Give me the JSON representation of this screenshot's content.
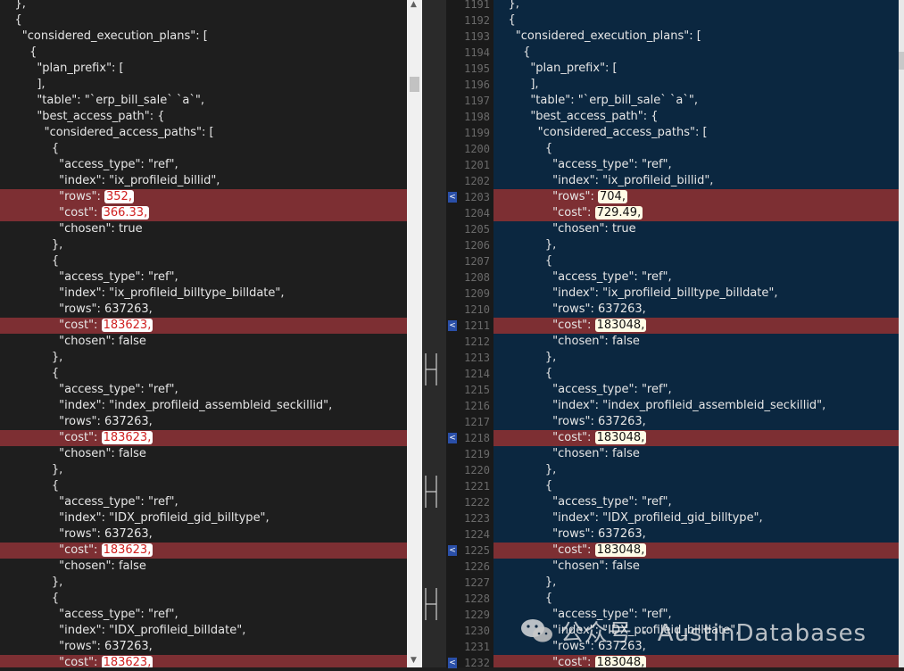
{
  "left_pane": {
    "lines": [
      {
        "indent": "    ",
        "parts": [
          {
            "t": "},"
          }
        ]
      },
      {
        "indent": "    ",
        "parts": [
          {
            "t": "{"
          }
        ]
      },
      {
        "indent": "      ",
        "parts": [
          {
            "t": "\"considered_execution_plans\": ["
          }
        ]
      },
      {
        "indent": "        ",
        "parts": [
          {
            "t": "{"
          }
        ]
      },
      {
        "indent": "          ",
        "parts": [
          {
            "t": "\"plan_prefix\": ["
          }
        ]
      },
      {
        "indent": "          ",
        "parts": [
          {
            "t": "],"
          }
        ]
      },
      {
        "indent": "          ",
        "parts": [
          {
            "t": "\"table\": \"`erp_bill_sale` `a`\","
          }
        ]
      },
      {
        "indent": "          ",
        "parts": [
          {
            "t": "\"best_access_path\": {"
          }
        ]
      },
      {
        "indent": "            ",
        "parts": [
          {
            "t": "\"considered_access_paths\": ["
          }
        ]
      },
      {
        "indent": "              ",
        "parts": [
          {
            "t": "{"
          }
        ]
      },
      {
        "indent": "                ",
        "parts": [
          {
            "t": "\"access_type\": \"ref\","
          }
        ]
      },
      {
        "indent": "                ",
        "parts": [
          {
            "t": "\"index\": \"ix_profileid_billid\","
          }
        ]
      },
      {
        "indent": "                ",
        "changed": true,
        "parts": [
          {
            "t": "\"rows\": "
          },
          {
            "t": "352,",
            "hl": true
          }
        ]
      },
      {
        "indent": "                ",
        "changed": true,
        "parts": [
          {
            "t": "\"cost\": "
          },
          {
            "t": "366.33,",
            "hl": true
          }
        ]
      },
      {
        "indent": "                ",
        "parts": [
          {
            "t": "\"chosen\": true"
          }
        ]
      },
      {
        "indent": "              ",
        "parts": [
          {
            "t": "},"
          }
        ]
      },
      {
        "indent": "              ",
        "parts": [
          {
            "t": "{"
          }
        ]
      },
      {
        "indent": "                ",
        "parts": [
          {
            "t": "\"access_type\": \"ref\","
          }
        ]
      },
      {
        "indent": "                ",
        "parts": [
          {
            "t": "\"index\": \"ix_profileid_billtype_billdate\","
          }
        ]
      },
      {
        "indent": "                ",
        "parts": [
          {
            "t": "\"rows\": 637263,"
          }
        ]
      },
      {
        "indent": "                ",
        "changed": true,
        "parts": [
          {
            "t": "\"cost\": "
          },
          {
            "t": "183623,",
            "hl": true
          }
        ]
      },
      {
        "indent": "                ",
        "parts": [
          {
            "t": "\"chosen\": false"
          }
        ]
      },
      {
        "indent": "              ",
        "parts": [
          {
            "t": "},"
          }
        ]
      },
      {
        "indent": "              ",
        "parts": [
          {
            "t": "{"
          }
        ]
      },
      {
        "indent": "                ",
        "parts": [
          {
            "t": "\"access_type\": \"ref\","
          }
        ]
      },
      {
        "indent": "                ",
        "parts": [
          {
            "t": "\"index\": \"index_profileid_assembleid_seckillid\","
          }
        ]
      },
      {
        "indent": "                ",
        "parts": [
          {
            "t": "\"rows\": 637263,"
          }
        ]
      },
      {
        "indent": "                ",
        "changed": true,
        "parts": [
          {
            "t": "\"cost\": "
          },
          {
            "t": "183623,",
            "hl": true
          }
        ]
      },
      {
        "indent": "                ",
        "parts": [
          {
            "t": "\"chosen\": false"
          }
        ]
      },
      {
        "indent": "              ",
        "parts": [
          {
            "t": "},"
          }
        ]
      },
      {
        "indent": "              ",
        "parts": [
          {
            "t": "{"
          }
        ]
      },
      {
        "indent": "                ",
        "parts": [
          {
            "t": "\"access_type\": \"ref\","
          }
        ]
      },
      {
        "indent": "                ",
        "parts": [
          {
            "t": "\"index\": \"IDX_profileid_gid_billtype\","
          }
        ]
      },
      {
        "indent": "                ",
        "parts": [
          {
            "t": "\"rows\": 637263,"
          }
        ]
      },
      {
        "indent": "                ",
        "changed": true,
        "parts": [
          {
            "t": "\"cost\": "
          },
          {
            "t": "183623,",
            "hl": true
          }
        ]
      },
      {
        "indent": "                ",
        "parts": [
          {
            "t": "\"chosen\": false"
          }
        ]
      },
      {
        "indent": "              ",
        "parts": [
          {
            "t": "},"
          }
        ]
      },
      {
        "indent": "              ",
        "parts": [
          {
            "t": "{"
          }
        ]
      },
      {
        "indent": "                ",
        "parts": [
          {
            "t": "\"access_type\": \"ref\","
          }
        ]
      },
      {
        "indent": "                ",
        "parts": [
          {
            "t": "\"index\": \"IDX_profileid_billdate\","
          }
        ]
      },
      {
        "indent": "                ",
        "parts": [
          {
            "t": "\"rows\": 637263,"
          }
        ]
      },
      {
        "indent": "                ",
        "changed": true,
        "parts": [
          {
            "t": "\"cost\": "
          },
          {
            "t": "183623,",
            "hl": true
          }
        ]
      }
    ]
  },
  "right_pane": {
    "lines": [
      {
        "indent": "    ",
        "parts": [
          {
            "t": "},"
          }
        ]
      },
      {
        "indent": "    ",
        "parts": [
          {
            "t": "{"
          }
        ]
      },
      {
        "indent": "      ",
        "parts": [
          {
            "t": "\"considered_execution_plans\": ["
          }
        ]
      },
      {
        "indent": "        ",
        "parts": [
          {
            "t": "{"
          }
        ]
      },
      {
        "indent": "          ",
        "parts": [
          {
            "t": "\"plan_prefix\": ["
          }
        ]
      },
      {
        "indent": "          ",
        "parts": [
          {
            "t": "],"
          }
        ]
      },
      {
        "indent": "          ",
        "parts": [
          {
            "t": "\"table\": \"`erp_bill_sale` `a`\","
          }
        ]
      },
      {
        "indent": "          ",
        "parts": [
          {
            "t": "\"best_access_path\": {"
          }
        ]
      },
      {
        "indent": "            ",
        "parts": [
          {
            "t": "\"considered_access_paths\": ["
          }
        ]
      },
      {
        "indent": "              ",
        "parts": [
          {
            "t": "{"
          }
        ]
      },
      {
        "indent": "                ",
        "parts": [
          {
            "t": "\"access_type\": \"ref\","
          }
        ]
      },
      {
        "indent": "                ",
        "parts": [
          {
            "t": "\"index\": \"ix_profileid_billid\","
          }
        ]
      },
      {
        "indent": "                ",
        "changed": true,
        "parts": [
          {
            "t": "\"rows\": "
          },
          {
            "t": "704,",
            "hl": true
          }
        ]
      },
      {
        "indent": "                ",
        "changed": true,
        "parts": [
          {
            "t": "\"cost\": "
          },
          {
            "t": "729.49,",
            "hl": true
          }
        ]
      },
      {
        "indent": "                ",
        "parts": [
          {
            "t": "\"chosen\": true"
          }
        ]
      },
      {
        "indent": "              ",
        "parts": [
          {
            "t": "},"
          }
        ]
      },
      {
        "indent": "              ",
        "parts": [
          {
            "t": "{"
          }
        ]
      },
      {
        "indent": "                ",
        "parts": [
          {
            "t": "\"access_type\": \"ref\","
          }
        ]
      },
      {
        "indent": "                ",
        "parts": [
          {
            "t": "\"index\": \"ix_profileid_billtype_billdate\","
          }
        ]
      },
      {
        "indent": "                ",
        "parts": [
          {
            "t": "\"rows\": 637263,"
          }
        ]
      },
      {
        "indent": "                ",
        "changed": true,
        "parts": [
          {
            "t": "\"cost\": "
          },
          {
            "t": "183048,",
            "hl": true
          }
        ]
      },
      {
        "indent": "                ",
        "parts": [
          {
            "t": "\"chosen\": false"
          }
        ]
      },
      {
        "indent": "              ",
        "parts": [
          {
            "t": "},"
          }
        ]
      },
      {
        "indent": "              ",
        "parts": [
          {
            "t": "{"
          }
        ]
      },
      {
        "indent": "                ",
        "parts": [
          {
            "t": "\"access_type\": \"ref\","
          }
        ]
      },
      {
        "indent": "                ",
        "parts": [
          {
            "t": "\"index\": \"index_profileid_assembleid_seckillid\","
          }
        ]
      },
      {
        "indent": "                ",
        "parts": [
          {
            "t": "\"rows\": 637263,"
          }
        ]
      },
      {
        "indent": "                ",
        "changed": true,
        "parts": [
          {
            "t": "\"cost\": "
          },
          {
            "t": "183048,",
            "hl": true
          }
        ]
      },
      {
        "indent": "                ",
        "parts": [
          {
            "t": "\"chosen\": false"
          }
        ]
      },
      {
        "indent": "              ",
        "parts": [
          {
            "t": "},"
          }
        ]
      },
      {
        "indent": "              ",
        "parts": [
          {
            "t": "{"
          }
        ]
      },
      {
        "indent": "                ",
        "parts": [
          {
            "t": "\"access_type\": \"ref\","
          }
        ]
      },
      {
        "indent": "                ",
        "parts": [
          {
            "t": "\"index\": \"IDX_profileid_gid_billtype\","
          }
        ]
      },
      {
        "indent": "                ",
        "parts": [
          {
            "t": "\"rows\": 637263,"
          }
        ]
      },
      {
        "indent": "                ",
        "changed": true,
        "parts": [
          {
            "t": "\"cost\": "
          },
          {
            "t": "183048,",
            "hl": true
          }
        ]
      },
      {
        "indent": "                ",
        "parts": [
          {
            "t": "\"chosen\": false"
          }
        ]
      },
      {
        "indent": "              ",
        "parts": [
          {
            "t": "},"
          }
        ]
      },
      {
        "indent": "              ",
        "parts": [
          {
            "t": "{"
          }
        ]
      },
      {
        "indent": "                ",
        "parts": [
          {
            "t": "\"access_type\": \"ref\","
          }
        ]
      },
      {
        "indent": "                ",
        "parts": [
          {
            "t": "\"index\": \"IDX_profileid_billdate\","
          }
        ]
      },
      {
        "indent": "                ",
        "parts": [
          {
            "t": "\"rows\": 637263,"
          }
        ]
      },
      {
        "indent": "                ",
        "changed": true,
        "parts": [
          {
            "t": "\"cost\": "
          },
          {
            "t": "183048,",
            "hl": true
          }
        ]
      }
    ]
  },
  "gutter": {
    "numbers": [
      "1191",
      "1192",
      "1193",
      "1194",
      "1195",
      "1196",
      "1197",
      "1198",
      "1199",
      "1200",
      "1201",
      "1202",
      "1203",
      "1204",
      "1205",
      "1206",
      "1207",
      "1208",
      "1209",
      "1210",
      "1211",
      "1212",
      "1213",
      "1214",
      "1215",
      "1216",
      "1217",
      "1218",
      "1219",
      "1220",
      "1221",
      "1222",
      "1223",
      "1224",
      "1225",
      "1226",
      "1227",
      "1228",
      "1229",
      "1230",
      "1231",
      "1232"
    ],
    "marker_rows": [
      12,
      20,
      27,
      34,
      41
    ],
    "marker_glyph": "<"
  },
  "watermark": {
    "text": "公众号 · AustinDatabases",
    "icon": "wechat-icon"
  },
  "colors": {
    "left_bg": "#1e1e1e",
    "right_bg": "#0b2740",
    "changed_row": "#7d2f33",
    "left_highlight_text": "#d02020",
    "right_highlight_bg": "#fffbe6",
    "gutter_marker": "#2a4fa8"
  }
}
